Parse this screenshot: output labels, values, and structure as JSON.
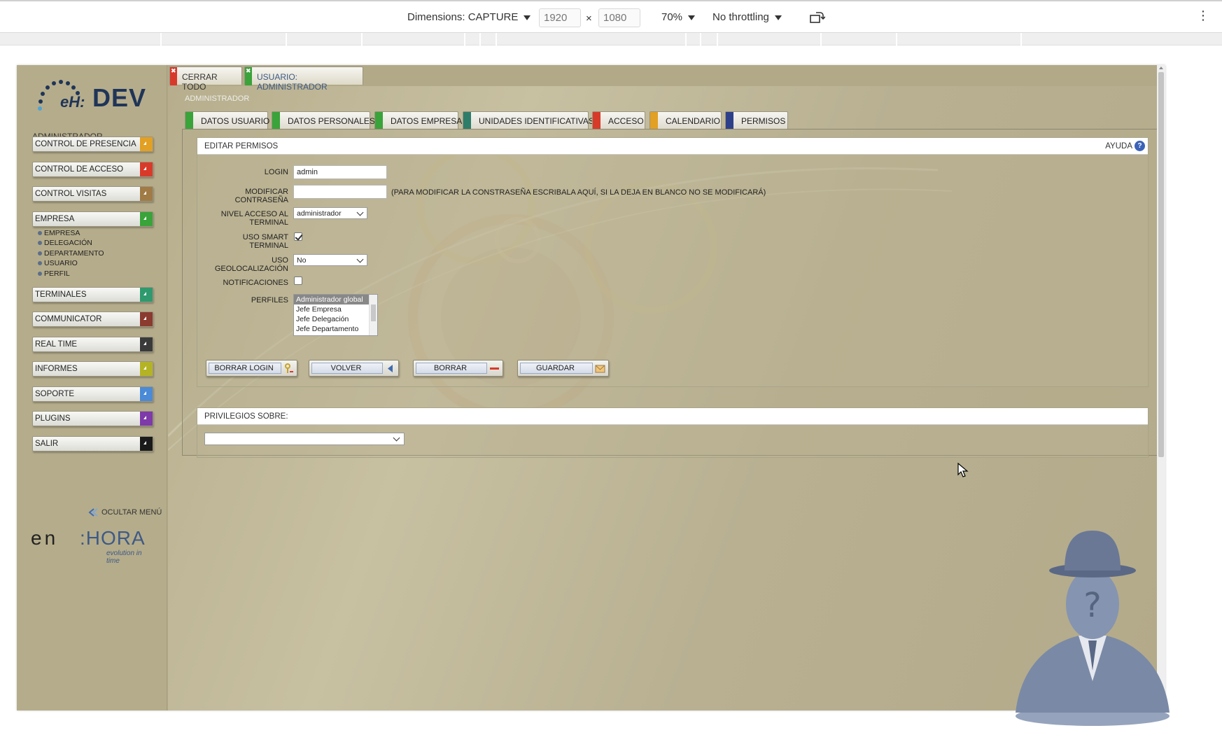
{
  "devtools": {
    "dimensions_label": "Dimensions: CAPTURE",
    "width": "1920",
    "height": "1080",
    "times": "×",
    "zoom": "70%",
    "throttling": "No throttling",
    "more": "⋮"
  },
  "sidebar": {
    "logo_prefix": "eH:",
    "logo_text": "DEV",
    "user": "ADMINISTRADOR",
    "menu": [
      {
        "label": "CONTROL DE PRESENCIA",
        "color": "#e2a024"
      },
      {
        "label": "CONTROL DE ACCESO",
        "color": "#d83a2a"
      },
      {
        "label": "CONTROL VISITAS",
        "color": "#a07b45"
      },
      {
        "label": "EMPRESA",
        "color": "#3aa33a"
      },
      {
        "label": "TERMINALES",
        "color": "#2e9a6e"
      },
      {
        "label": "COMMUNICATOR",
        "color": "#8a3a2e"
      },
      {
        "label": "REAL TIME",
        "color": "#3a3a3a"
      },
      {
        "label": "INFORMES",
        "color": "#b4b324"
      },
      {
        "label": "SOPORTE",
        "color": "#4a8ad6"
      },
      {
        "label": "PLUGINS",
        "color": "#7d3aa8"
      },
      {
        "label": "SALIR",
        "color": "#1a1a1a"
      }
    ],
    "submenu": [
      "EMPRESA",
      "DELEGACIÓN",
      "DEPARTAMENTO",
      "USUARIO",
      "PERFIL"
    ],
    "hide_menu": "OCULTAR MENÚ",
    "brand_a": "en",
    "brand_b": ":HORA",
    "brand_tagline": "evolution in time"
  },
  "top_tabs": [
    {
      "label": "CERRAR TODO",
      "color": "#d83a2a"
    },
    {
      "label": "USUARIO: ADMINISTRADOR",
      "color": "#3aa33a"
    }
  ],
  "breadcrumb": "ADMINISTRADOR",
  "section_tabs": [
    {
      "label": "DATOS USUARIO",
      "color": "#3aa33a"
    },
    {
      "label": "DATOS PERSONALES",
      "color": "#3aa33a"
    },
    {
      "label": "DATOS EMPRESA",
      "color": "#3aa33a"
    },
    {
      "label": "UNIDADES IDENTIFICATIVAS",
      "color": "#2e7d6a"
    },
    {
      "label": "ACCESO",
      "color": "#d83a2a"
    },
    {
      "label": "CALENDARIO",
      "color": "#e2a024"
    },
    {
      "label": "PERMISOS",
      "color": "#2e3f8a"
    }
  ],
  "form": {
    "title": "EDITAR PERMISOS",
    "help": "AYUDA",
    "login_label": "LOGIN",
    "login_value": "admin",
    "password_label": "MODIFICAR CONTRASEÑA",
    "password_hint": "(PARA MODIFICAR LA CONSTRASEÑA ESCRIBALA AQUÍ, SI LA DEJA EN BLANCO NO SE MODIFICARÁ)",
    "terminal_label": "NIVEL ACCESO AL TERMINAL",
    "terminal_value": "administrador",
    "smart_label": "USO SMART TERMINAL",
    "smart_checked": true,
    "geo_label": "USO GEOLOCALIZACIÓN",
    "geo_value": "No",
    "notif_label": "NOTIFICACIONES",
    "notif_checked": false,
    "profiles_label": "PERFILES",
    "profiles": [
      "Administrador global",
      "Jefe Empresa",
      "Jefe Delegación",
      "Jefe Departamento"
    ],
    "buttons": {
      "clear_login": "BORRAR LOGIN",
      "back": "VOLVER",
      "delete": "BORRAR",
      "save": "GUARDAR"
    }
  },
  "privileges": {
    "title": "PRIVILEGIOS SOBRE:"
  }
}
